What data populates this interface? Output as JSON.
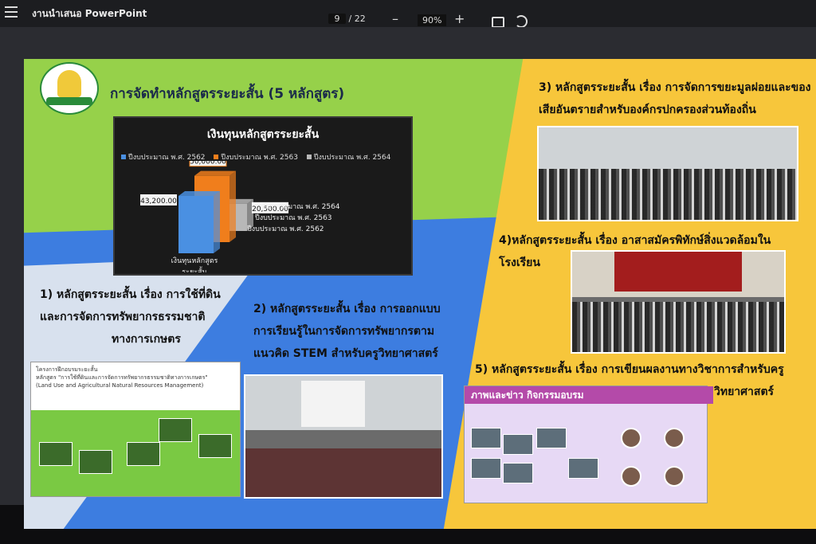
{
  "toolbar": {
    "app_title": "งานนำเสนอ PowerPoint",
    "current_page": "9",
    "total_pages": "/ 22",
    "zoom_out": "–",
    "zoom": "90%",
    "zoom_in": "+"
  },
  "slide": {
    "title": "การจัดทำหลักสูตรระยะสั้น (5 หลักสูตร)",
    "chart_title": "เงินทุนหลักสูตรระยะสั้น",
    "item1": [
      "1) หลักสูตรระยะสั้น เรื่อง การใช้ที่ดิน",
      "และการจัดการทรัพยากรธรรมชาติ",
      "ทางการเกษตร"
    ],
    "item2": [
      "2) หลักสูตรระยะสั้น เรื่อง การออกแบบ",
      "การเรียนรู้ในการจัดการทรัพยากรตาม",
      "แนวคิด STEM สำหรับครูวิทยาศาสตร์"
    ],
    "item3": [
      "3) หลักสูตรระยะสั้น เรื่อง การจัดการขยะมูลฝอยและของ",
      "เสียอันตรายสำหรับองค์กรปกครองส่วนท้องถิ่น"
    ],
    "item4": [
      "4)หลักสูตรระยะสั้น เรื่อง อาสาสมัครพิทักษ์สิ่งแวดล้อมใน",
      "โรงเรียน"
    ],
    "item5": [
      "5) หลักสูตรระยะสั้น เรื่อง การเขียนผลงานทางวิชาการสำหรับครู",
      "วิทยาศาสตร์"
    ],
    "poster1_header": [
      "โครงการฝึกอบรมระยะสั้น",
      "หลักสูตร \"การใช้ที่ดินและการจัดการทรัพยากรธรรมชาติทางการเกษตร\"",
      "(Land Use and Agricultural Natural Resources Management)"
    ],
    "poster5_header": "ภาพและข่าว กิจกรรมอบรม"
  },
  "colors": {
    "green": "#96d14a",
    "blue": "#3d7de0",
    "yellow": "#f7c63b",
    "series_2562": "#4a90e2",
    "series_2563": "#f07e1c",
    "series_2564": "#b8b8b8"
  },
  "chart_data": {
    "type": "bar",
    "title": "เงินทุนหลักสูตรระยะสั้น",
    "legend_position": "top",
    "categories": [
      "เงินทุนหลักสูตรระยะสั้น"
    ],
    "series": [
      {
        "name": "ปีงบประมาณ พ.ศ. 2562",
        "values": [
          43200
        ],
        "label": "43,200.00"
      },
      {
        "name": "ปีงบประมาณ พ.ศ. 2563",
        "values": [
          50000
        ],
        "label": "50,000.00"
      },
      {
        "name": "ปีงบประมาณ พ.ศ. 2564",
        "values": [
          20500
        ],
        "label": "20,500.00"
      }
    ],
    "depth_labels": [
      "ปีงบประมาณ พ.ศ. 2564",
      "ปีงบประมาณ พ.ศ. 2563",
      "ปีงบประมาณ พ.ศ. 2562"
    ],
    "category_label_lines": [
      "เงินทุนหลักสูตร",
      "ระยะสั้น"
    ]
  }
}
